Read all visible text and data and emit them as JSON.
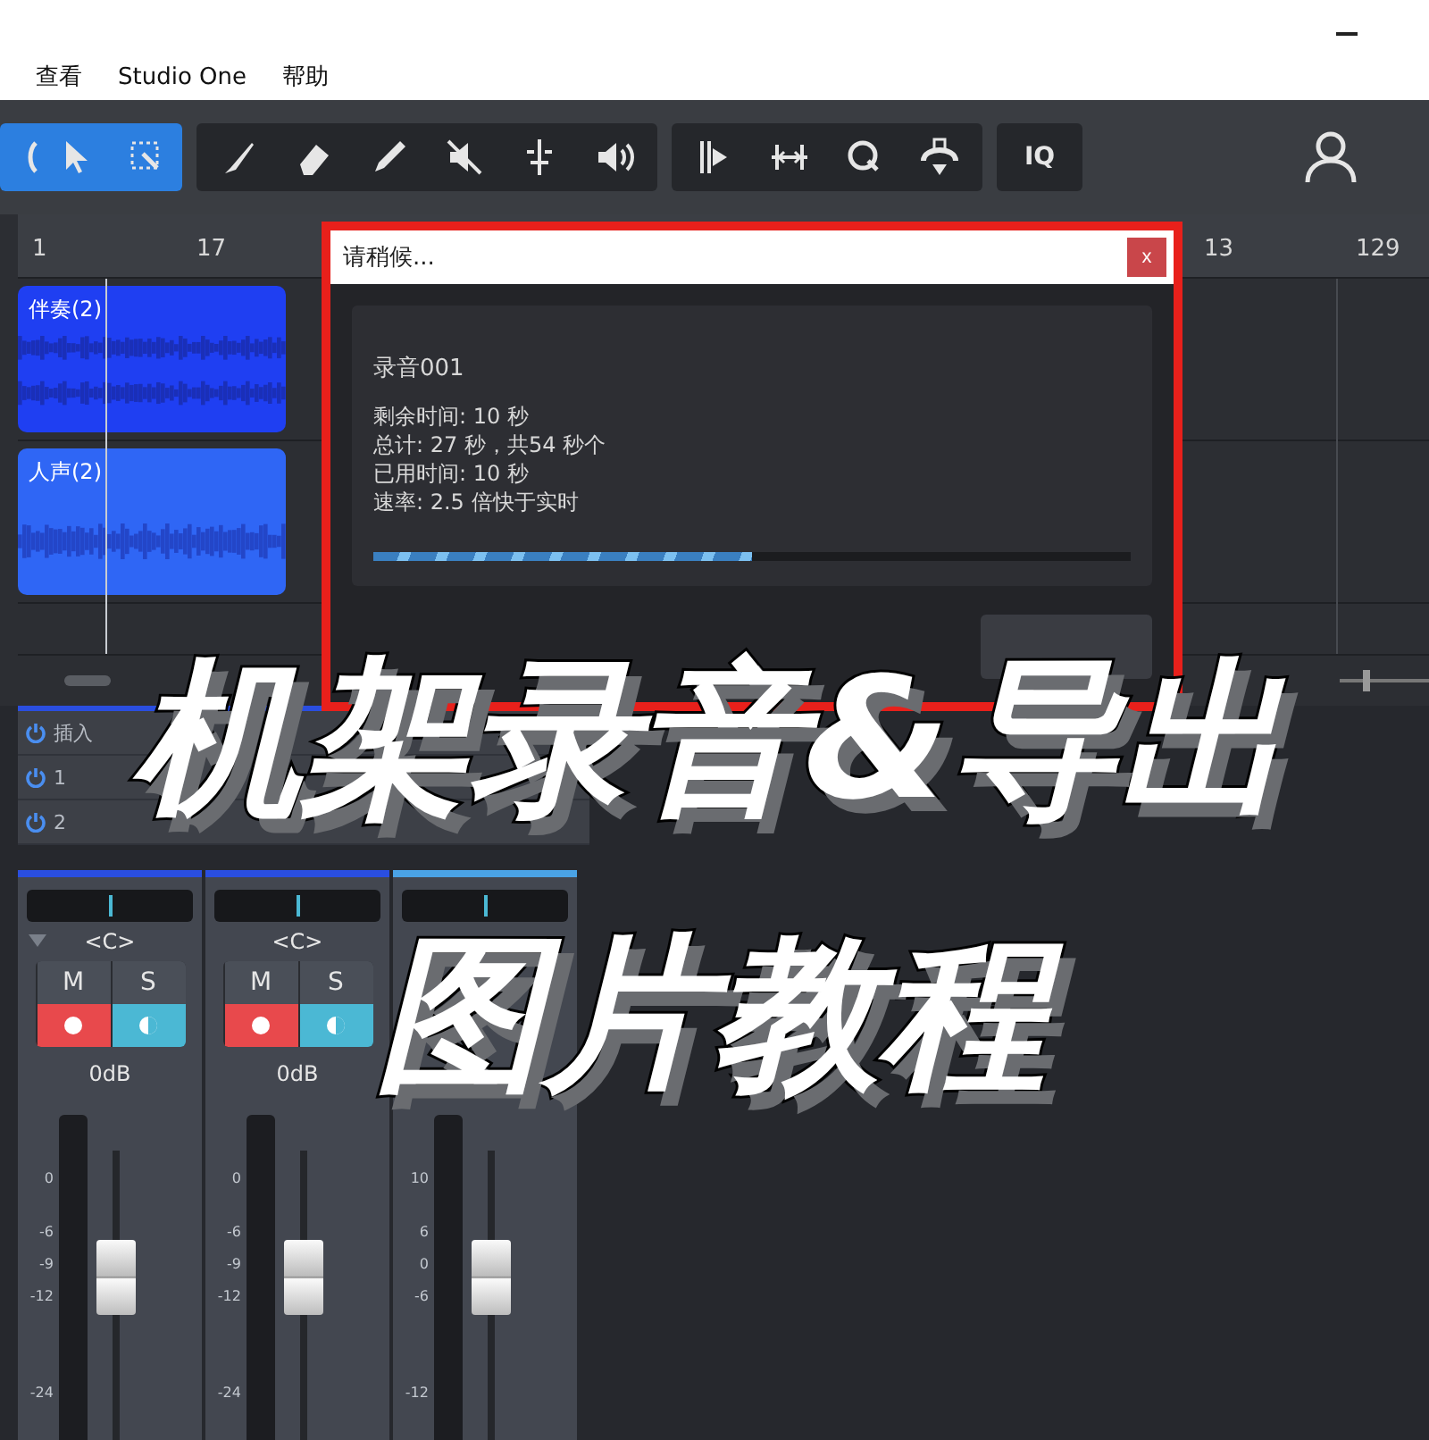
{
  "menu": [
    "查看",
    "Studio One",
    "帮助"
  ],
  "toolbar": {
    "groups": [
      [
        {
          "kind": "edge",
          "selected": true
        },
        {
          "kind": "arrow",
          "selected": true
        },
        {
          "kind": "range",
          "selected": true
        }
      ],
      [
        {
          "kind": "knife",
          "selected": false
        },
        {
          "kind": "eraser",
          "selected": false
        },
        {
          "kind": "pencil",
          "selected": false
        },
        {
          "kind": "mute",
          "selected": false
        },
        {
          "kind": "split",
          "selected": false
        },
        {
          "kind": "speaker",
          "selected": false
        }
      ],
      [
        {
          "kind": "bend",
          "selected": false
        },
        {
          "kind": "stretch",
          "selected": false
        },
        {
          "kind": "quantize",
          "selected": false
        },
        {
          "kind": "listen",
          "selected": false
        }
      ],
      [
        {
          "kind": "text",
          "label": "IQ",
          "selected": false
        }
      ]
    ]
  },
  "ruler": [
    "1",
    "17",
    "13",
    "129"
  ],
  "tracks": [
    {
      "clip": "伴奏(2)",
      "color": "#1f3ff2"
    },
    {
      "clip": "人声(2)",
      "color": "#2f66f5"
    }
  ],
  "dialog": {
    "title": "请稍候...",
    "close": "x",
    "name": "录音001",
    "lines": [
      "剩余时间: 10 秒",
      "总计: 27 秒，共54 秒个",
      "已用时间: 10 秒",
      "速率: 2.5 倍快于实时"
    ],
    "progress": {
      "level": 0.5
    }
  },
  "inserts": [
    "插入",
    "1",
    "2"
  ],
  "channels": [
    {
      "pan": "<C>",
      "mute": "M",
      "solo": "S",
      "armed": true,
      "monitor": true,
      "volume": "0dB",
      "scale": [
        "0",
        "-6",
        "-9",
        "-12",
        "-24"
      ],
      "fader": {
        "level": 0.62
      }
    },
    {
      "pan": "<C>",
      "mute": "M",
      "solo": "S",
      "armed": true,
      "monitor": true,
      "volume": "0dB",
      "scale": [
        "0",
        "-6",
        "-9",
        "-12",
        "-24"
      ],
      "fader": {
        "level": 0.62
      }
    },
    {
      "scale": [
        "10",
        "6",
        "0",
        "-6",
        "-12"
      ],
      "fader": {
        "level": 0.62
      }
    }
  ],
  "zoom": {
    "level": 0.3
  },
  "overlay": [
    "机架录音&导出",
    "图片教程"
  ]
}
